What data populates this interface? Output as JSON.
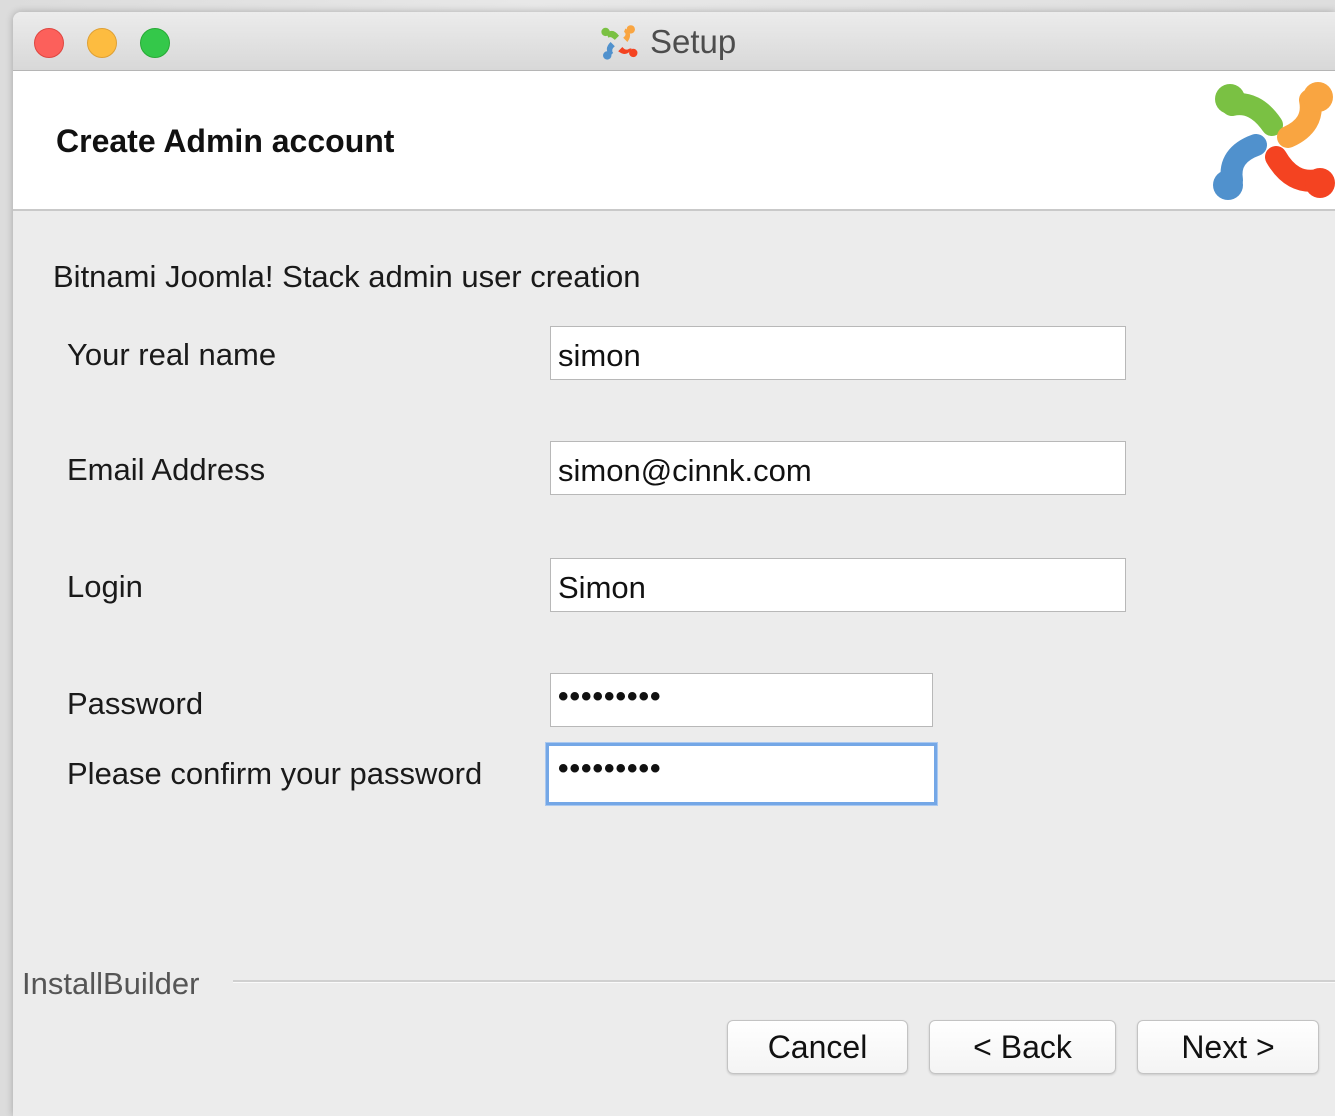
{
  "window": {
    "title": "Setup"
  },
  "header": {
    "title": "Create Admin account",
    "logo": "joomla-logo"
  },
  "form": {
    "subtitle": "Bitnami Joomla! Stack admin user creation",
    "fields": [
      {
        "label": "Your real name",
        "value": "simon"
      },
      {
        "label": "Email Address",
        "value": "simon@cinnk.com"
      },
      {
        "label": "Login",
        "value": "Simon"
      },
      {
        "label": "Password",
        "value": "•••••••••"
      },
      {
        "label": "Please confirm your password",
        "value": "•••••••••"
      }
    ]
  },
  "footer": {
    "brand": "InstallBuilder",
    "cancel": "Cancel",
    "back": "< Back",
    "next": "Next >"
  },
  "colors": {
    "close": "#fc605b",
    "minimize": "#fdbc40",
    "maximize": "#34c84a",
    "focus_ring": "#74a7e6"
  }
}
